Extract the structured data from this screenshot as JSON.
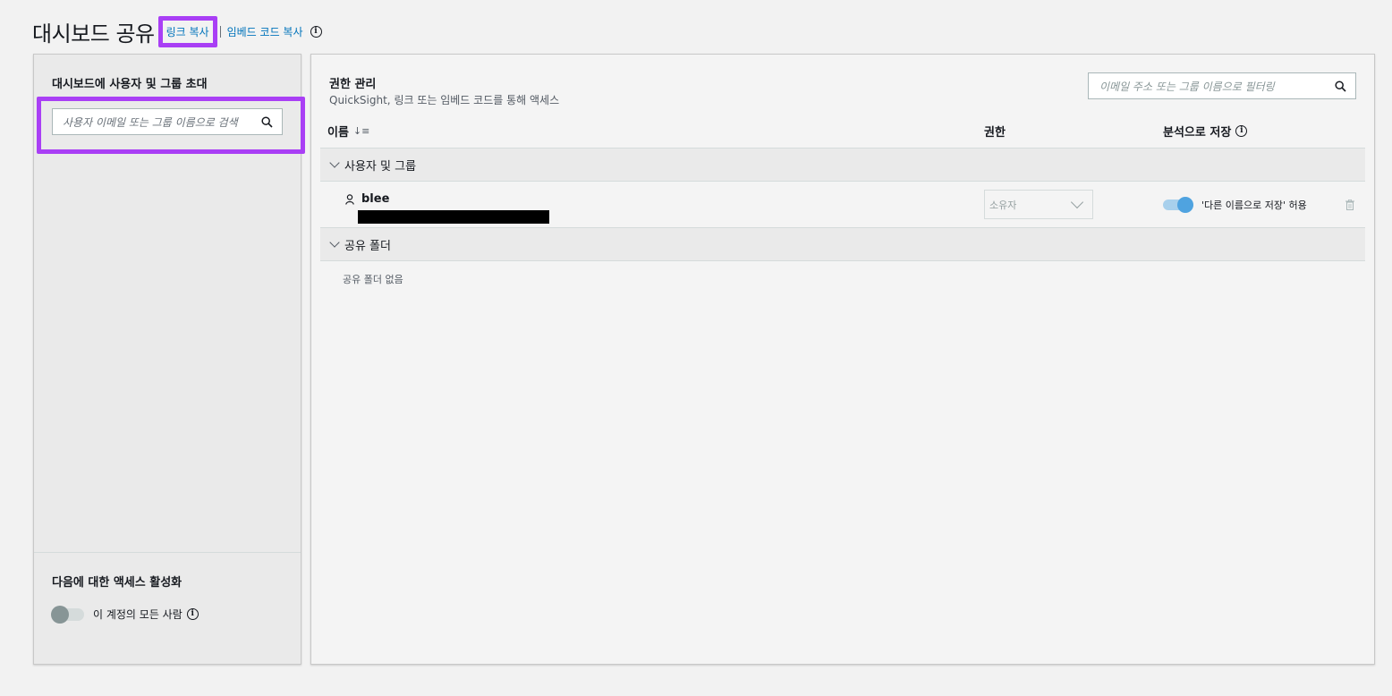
{
  "header": {
    "title": "대시보드 공유",
    "copy_link": "링크 복사",
    "copy_embed": "임베드 코드 복사"
  },
  "left": {
    "invite_title": "대시보드에 사용자 및 그룹 초대",
    "search_placeholder": "사용자 이메일 또는 그룹 이름으로 검색",
    "enable_access_title": "다음에 대한 액세스 활성화",
    "everyone_label": "이 계정의 모든 사람",
    "everyone_enabled": false
  },
  "right": {
    "title": "권한 관리",
    "subtitle": "QuickSight, 링크 또는 임베드 코드를 통해 액세스",
    "filter_placeholder": "이메일 주소 또는 그룹 이름으로 필터링",
    "columns": {
      "name": "이름",
      "permission": "권한",
      "save_as": "분석으로 저장"
    },
    "groups": {
      "users": "사용자 및 그룹",
      "folders": "공유 폴더"
    },
    "users": [
      {
        "name": "blee",
        "role": "소유자",
        "save_as_label": "'다른 이름으로 저장' 허용",
        "save_as_enabled": true
      }
    ],
    "no_folders": "공유 폴더 없음"
  },
  "colors": {
    "accent": "#0073bb",
    "highlight": "#a93ff5",
    "toggle_on": "#4fa3e0"
  }
}
